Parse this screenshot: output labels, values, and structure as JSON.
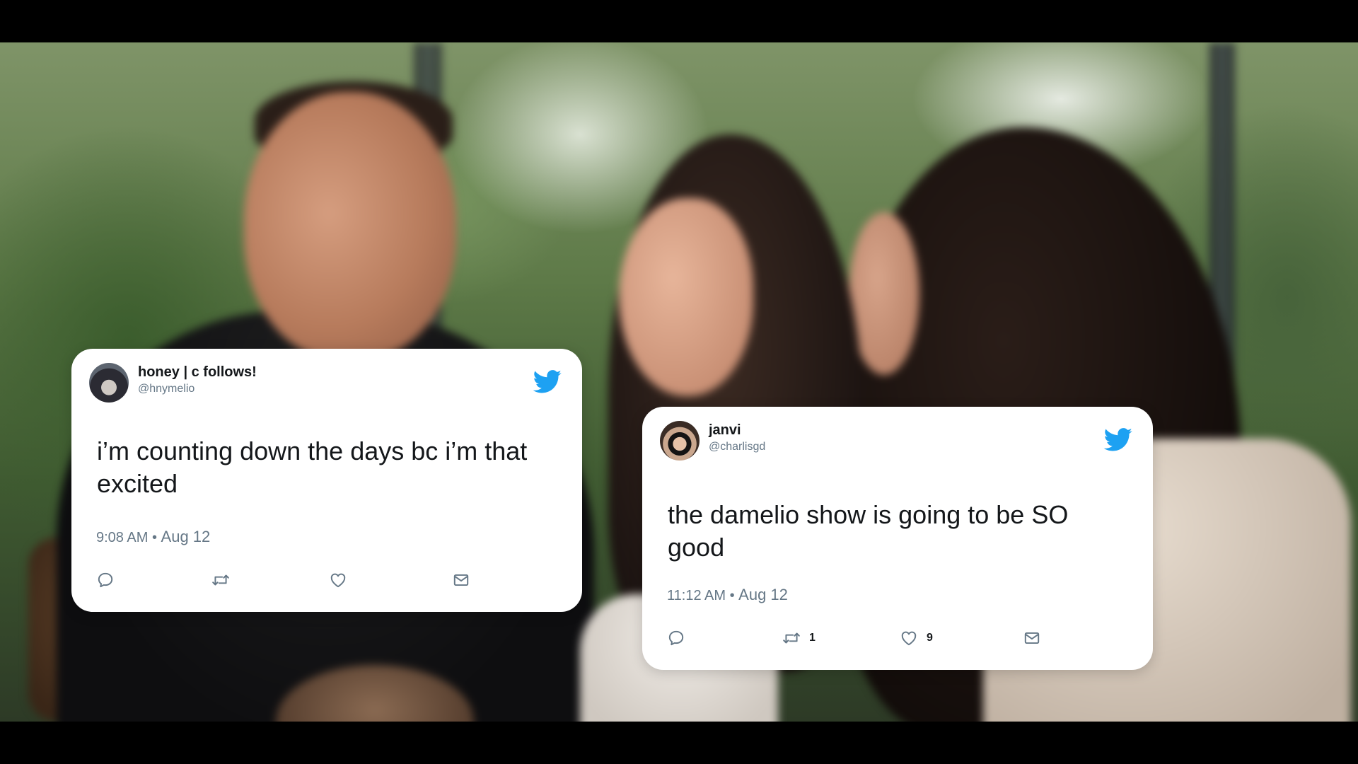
{
  "tweets": [
    {
      "display_name": "honey | c follows!",
      "handle": "@hnymelio",
      "text": "i’m counting down the days bc i’m that excited",
      "time": "9:08 AM",
      "separator": "•",
      "date": "Aug 12",
      "retweets": "",
      "likes": ""
    },
    {
      "display_name": "janvi",
      "handle": "@charlisgd",
      "text": "the damelio show is going to be SO good",
      "time": "11:12 AM",
      "separator": "•",
      "date": "Aug 12",
      "retweets": "1",
      "likes": "9"
    }
  ],
  "icons": {
    "brand": "twitter-bird-icon",
    "reply": "reply-icon",
    "retweet": "retweet-icon",
    "like": "heart-icon",
    "share": "mail-icon"
  },
  "colors": {
    "twitter_blue": "#1da1f2",
    "text_primary": "#14171a",
    "text_secondary": "#657786",
    "card_bg": "#ffffff"
  }
}
